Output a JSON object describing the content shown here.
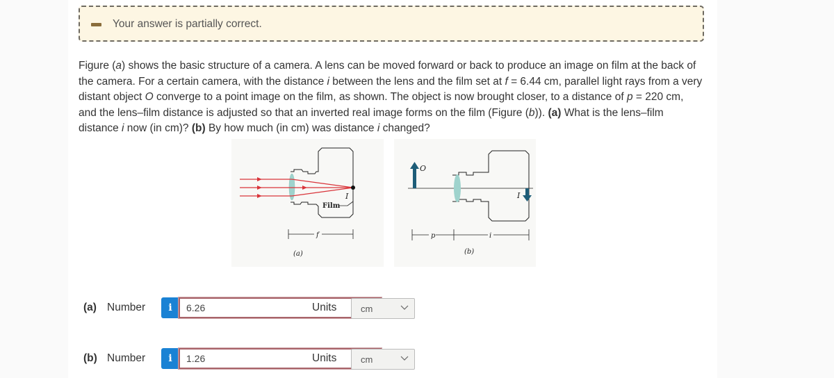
{
  "feedback": {
    "status_icon": "partial-dash-icon",
    "message": "Your answer is partially correct."
  },
  "question": {
    "parts": [
      {
        "t": "Figure ("
      },
      {
        "t": "a",
        "i": true
      },
      {
        "t": ") shows the basic structure of a camera. A lens can be moved forward or back to produce an image on film at the back of the camera. For a certain camera, with the distance "
      },
      {
        "t": "i",
        "i": true
      },
      {
        "t": " between the lens and the film set at "
      },
      {
        "t": "f",
        "i": true
      },
      {
        "t": " = 6.44 cm, parallel light rays from a very distant object "
      },
      {
        "t": "O",
        "i": true
      },
      {
        "t": " converge to a point image on the film, as shown. The object is now brought closer, to a distance of "
      },
      {
        "t": "p",
        "i": true
      },
      {
        "t": " = 220 cm, and the lens–film distance is adjusted so that an inverted real image forms on the film (Figure ("
      },
      {
        "t": "b",
        "i": true
      },
      {
        "t": ")). "
      },
      {
        "t": "(a)",
        "b": true
      },
      {
        "t": " What is the lens–film distance "
      },
      {
        "t": "i",
        "i": true
      },
      {
        "t": " now (in cm)? "
      },
      {
        "t": "(b)",
        "b": true
      },
      {
        "t": " By how much (in cm) was distance "
      },
      {
        "t": "i",
        "i": true
      },
      {
        "t": " changed?"
      }
    ]
  },
  "figure": {
    "a": {
      "caption": "(a)",
      "film_label": "Film",
      "image_label": "I",
      "dimension_label": "f"
    },
    "b": {
      "caption": "(b)",
      "object_label": "O",
      "image_label": "I",
      "dimension_p": "p",
      "dimension_i": "i"
    },
    "colors": {
      "ray": "#d9343a",
      "lens": "#9fd3cd",
      "arrow": "#1e5d78",
      "line": "#222222"
    }
  },
  "answers": [
    {
      "part": "(a)",
      "label": "Number",
      "info_icon": "i",
      "value": "6.26",
      "units_label": "Units",
      "unit": "cm"
    },
    {
      "part": "(b)",
      "label": "Number",
      "info_icon": "i",
      "value": "1.26",
      "units_label": "Units",
      "unit": "cm"
    }
  ]
}
